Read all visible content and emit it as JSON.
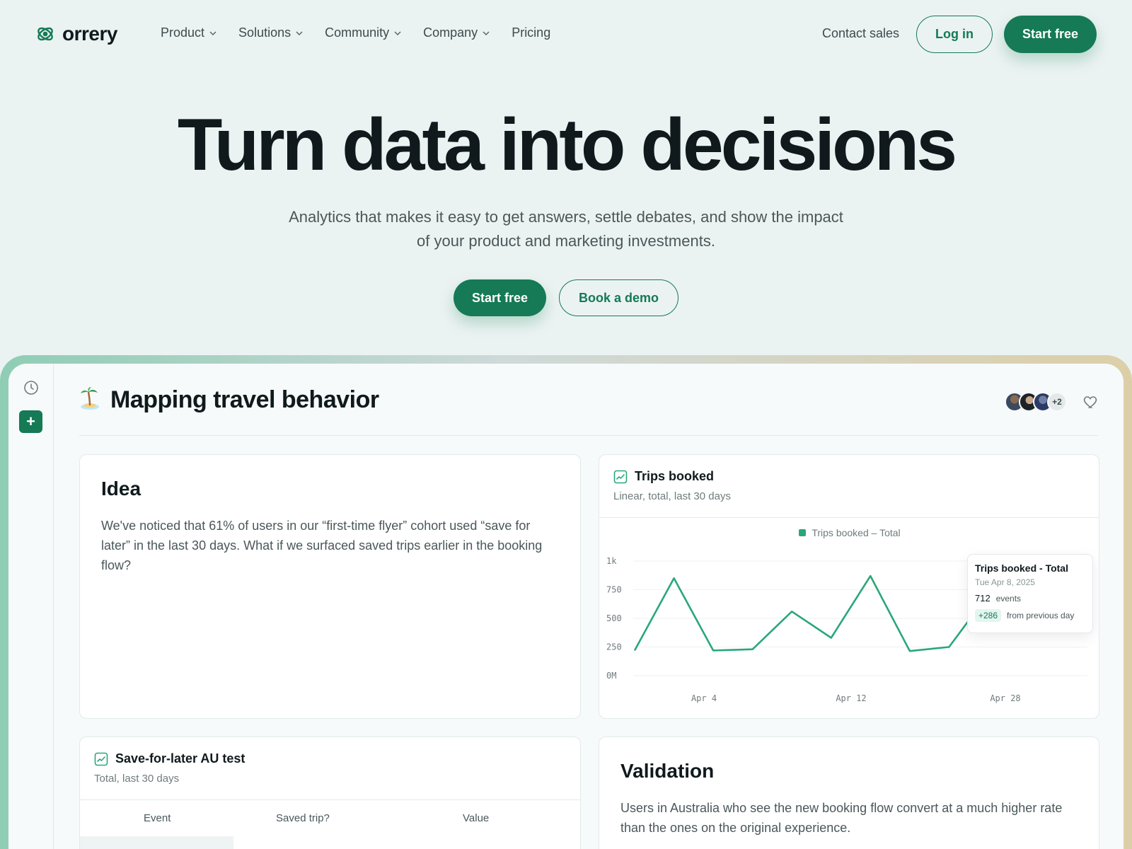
{
  "brand": {
    "name": "orrery",
    "accent": "#157a55"
  },
  "nav": {
    "links": [
      {
        "label": "Product",
        "has_dropdown": true
      },
      {
        "label": "Solutions",
        "has_dropdown": true
      },
      {
        "label": "Community",
        "has_dropdown": true
      },
      {
        "label": "Company",
        "has_dropdown": true
      },
      {
        "label": "Pricing",
        "has_dropdown": false
      }
    ],
    "contact_sales": "Contact sales",
    "login": "Log in",
    "start_free": "Start free"
  },
  "hero": {
    "title": "Turn data into decisions",
    "subtitle": "Analytics that makes it easy to get answers, settle debates, and show the impact of your product and marketing investments.",
    "cta_primary": "Start free",
    "cta_secondary": "Book a demo"
  },
  "board": {
    "emoji": "desert-island-icon",
    "title": "Mapping travel behavior",
    "collaborators_more": "+2"
  },
  "idea_card": {
    "heading": "Idea",
    "body": "We've noticed that 61% of users in our “first-time flyer” cohort used “save for later” in the last 30 days. What if we surfaced saved trips earlier in the booking flow?"
  },
  "trips_card": {
    "title": "Trips booked",
    "subtitle": "Linear, total, last 30 days",
    "legend": "Trips booked – Total",
    "tooltip": {
      "title": "Trips booked - Total",
      "date": "Tue Apr 8, 2025",
      "value": "712",
      "value_unit": "events",
      "delta": "+286",
      "delta_label": "from previous day"
    }
  },
  "chart_data": {
    "type": "line",
    "series": [
      {
        "name": "Trips booked – Total",
        "color": "#2aa77a",
        "values": [
          220,
          850,
          220,
          230,
          560,
          330,
          870,
          215,
          250,
          712
        ]
      }
    ],
    "x_tick_labels": [
      "Apr 4",
      "Apr 12",
      "Apr 28"
    ],
    "y_tick_labels": [
      "1k",
      "750",
      "500",
      "250",
      "0M"
    ],
    "ylim": [
      0,
      1000
    ],
    "grid": true,
    "legend_placement": "top-center"
  },
  "test_card": {
    "title": "Save-for-later AU test",
    "subtitle": "Total, last 30 days",
    "columns": [
      "Event",
      "Saved trip?",
      "Value"
    ]
  },
  "validation_card": {
    "heading": "Validation",
    "body": "Users in Australia who see the new booking flow convert at a much higher rate than the ones on the original experience."
  }
}
